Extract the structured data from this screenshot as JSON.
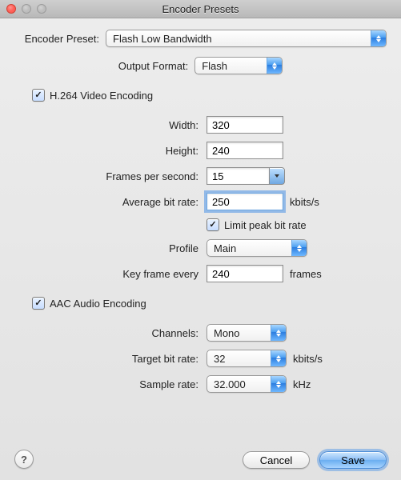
{
  "window": {
    "title": "Encoder Presets"
  },
  "preset": {
    "label": "Encoder Preset:",
    "value": "Flash Low Bandwidth"
  },
  "output_format": {
    "label": "Output Format:",
    "value": "Flash"
  },
  "video": {
    "section_label": "H.264 Video Encoding",
    "enabled": true,
    "width_label": "Width:",
    "width_value": "320",
    "height_label": "Height:",
    "height_value": "240",
    "fps_label": "Frames per second:",
    "fps_value": "15",
    "avg_bitrate_label": "Average bit rate:",
    "avg_bitrate_value": "250",
    "avg_bitrate_unit": "kbits/s",
    "limit_peak_checked": true,
    "limit_peak_label": "Limit peak bit rate",
    "profile_label": "Profile",
    "profile_value": "Main",
    "keyframe_label": "Key frame every",
    "keyframe_value": "240",
    "keyframe_unit": "frames"
  },
  "audio": {
    "section_label": "AAC Audio Encoding",
    "enabled": true,
    "channels_label": "Channels:",
    "channels_value": "Mono",
    "target_bitrate_label": "Target bit rate:",
    "target_bitrate_value": "32",
    "target_bitrate_unit": "kbits/s",
    "sample_rate_label": "Sample rate:",
    "sample_rate_value": "32.000",
    "sample_rate_unit": "kHz"
  },
  "buttons": {
    "help": "?",
    "cancel": "Cancel",
    "save": "Save"
  }
}
